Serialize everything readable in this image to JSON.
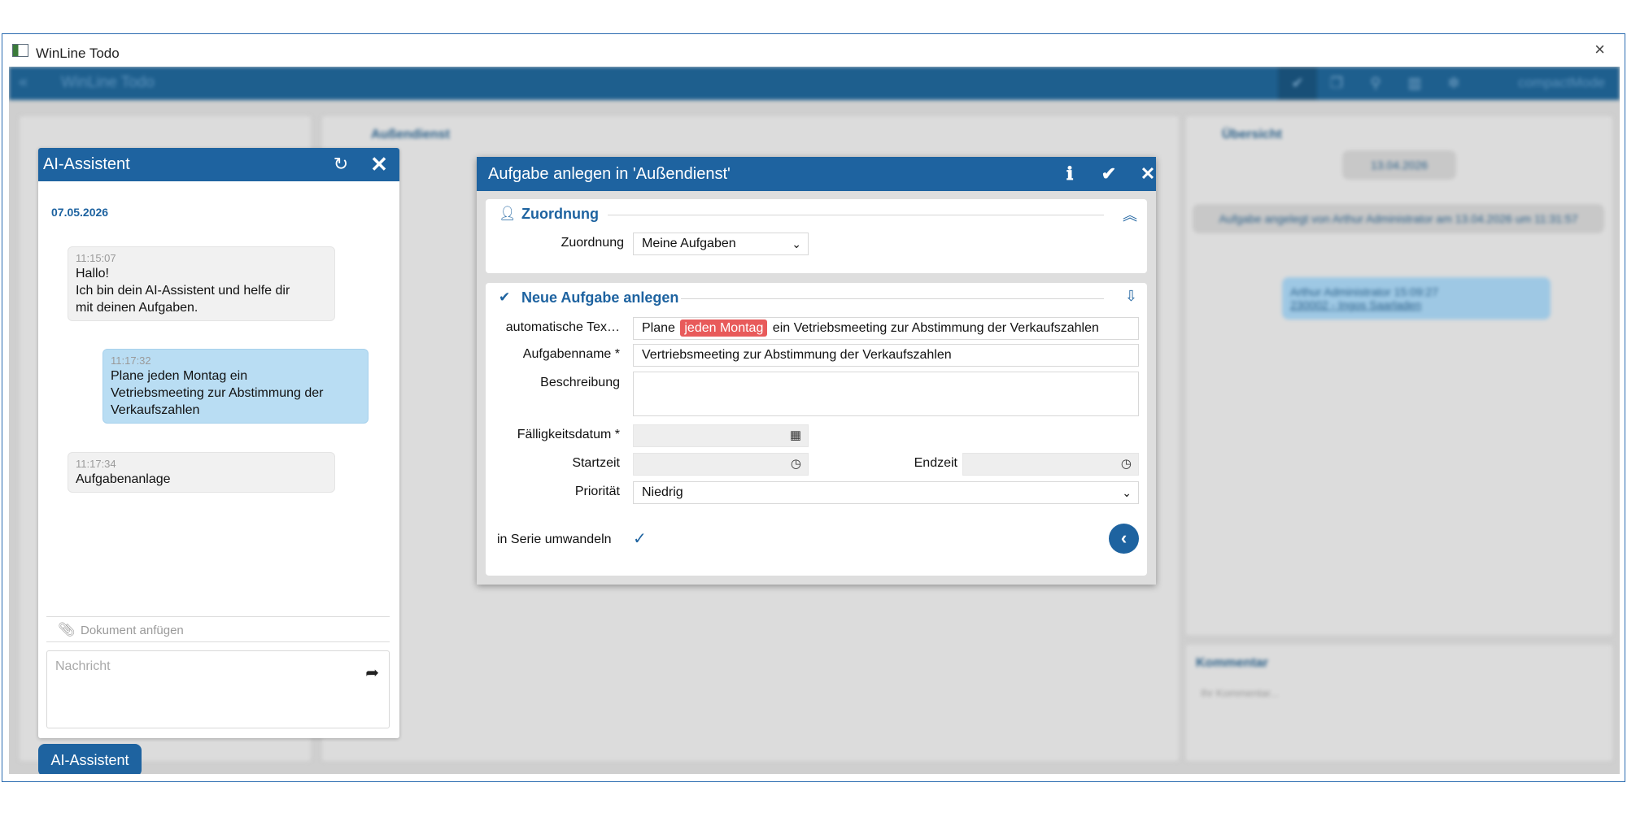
{
  "window": {
    "title": "WinLine Todo",
    "close_icon": "×"
  },
  "app": {
    "header_title": "WinLine Todo",
    "compact_mode": "compactMode",
    "bg_center_title": "Außendienst",
    "bg_overview_title": "Übersicht",
    "bg_overview_date": "13.04.2026",
    "bg_overview_created": "Aufgabe angelegt von Arthur Administrator am 13.04.2026 um 11:31:57",
    "bg_chat_author": "Arthur Administrator 15:09:27",
    "bg_chat_link": "230002 - Ingos Saarladen",
    "bg_comment_title": "Kommentar",
    "bg_comment_placeholder": "Ihr Kommentar..."
  },
  "ai_panel": {
    "title": "AI-Assistent",
    "date": "07.05.2026",
    "messages": [
      {
        "role": "bot",
        "time": "11:15:07",
        "text": "Hallo!\nIch bin dein AI-Assistent und helfe dir\nmit deinen Aufgaben."
      },
      {
        "role": "user",
        "time": "11:17:32",
        "text": "Plane jeden Montag ein\nVetriebsmeeting zur Abstimmung der\nVerkaufszahlen"
      },
      {
        "role": "bot",
        "time": "11:17:34",
        "text": "Aufgabenanlage"
      }
    ],
    "attach_label": "Dokument anfügen",
    "input_placeholder": "Nachricht",
    "button_label": "AI-Assistent"
  },
  "dialog": {
    "title": "Aufgabe anlegen in 'Außendienst'",
    "section_assignment": {
      "title": "Zuordnung",
      "label": "Zuordnung",
      "value": "Meine Aufgaben"
    },
    "section_new_task": {
      "title": "Neue Aufgabe anlegen",
      "auto_text_label": "automatische Tex…",
      "auto_text_before": "Plane",
      "auto_text_highlight": "jeden Montag",
      "auto_text_after": "ein Vetriebsmeeting zur Abstimmung der Verkaufszahlen",
      "task_name_label": "Aufgabenname *",
      "task_name_value": "Vertriebsmeeting zur Abstimmung der Verkaufszahlen",
      "description_label": "Beschreibung",
      "description_value": "",
      "due_date_label": "Fälligkeitsdatum *",
      "due_date_value": "",
      "start_label": "Startzeit",
      "start_value": "",
      "end_label": "Endzeit",
      "end_value": "",
      "priority_label": "Priorität",
      "priority_value": "Niedrig",
      "series_label": "in Serie umwandeln"
    }
  },
  "colors": {
    "primary": "#1e63a0",
    "highlight": "#e85a5a",
    "user_bubble": "#b9ddf3"
  }
}
